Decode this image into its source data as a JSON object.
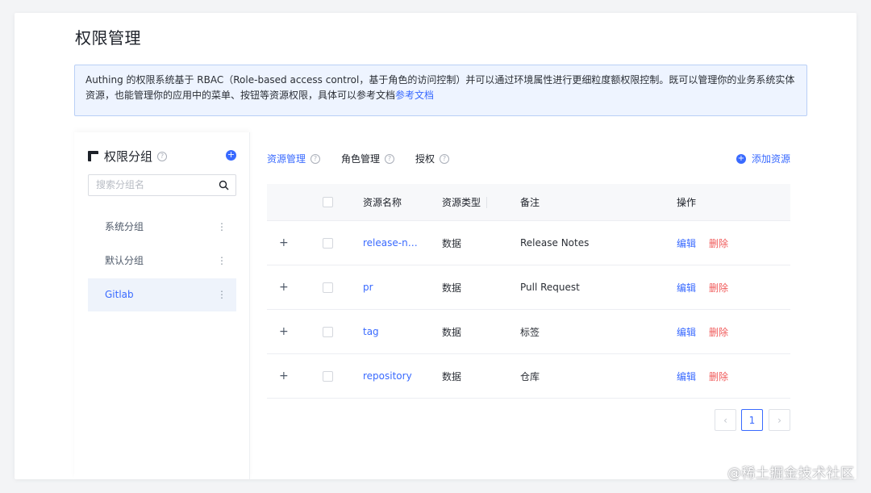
{
  "page": {
    "title": "权限管理"
  },
  "notice": {
    "text": "Authing 的权限系统基于 RBAC（Role-based access control，基于角色的访问控制）并可以通过环境属性进行更细粒度额权限控制。既可以管理你的业务系统实体资源，也能管理你的应用中的菜单、按钮等资源权限，具体可以参考文档",
    "link": "参考文档"
  },
  "sidebar": {
    "title": "权限分组",
    "search_placeholder": "搜索分组名",
    "groups": [
      {
        "label": "系统分组",
        "active": false
      },
      {
        "label": "默认分组",
        "active": false
      },
      {
        "label": "Gitlab",
        "active": true
      }
    ]
  },
  "tabs": [
    {
      "label": "资源管理",
      "active": true
    },
    {
      "label": "角色管理",
      "active": false
    },
    {
      "label": "授权",
      "active": false
    }
  ],
  "add_resource_label": "添加资源",
  "table": {
    "headers": {
      "name": "资源名称",
      "type": "资源类型",
      "note": "备注",
      "op": "操作"
    },
    "rows": [
      {
        "name": "release-notes",
        "type": "数据",
        "note": "Release Notes"
      },
      {
        "name": "pr",
        "type": "数据",
        "note": "Pull Request"
      },
      {
        "name": "tag",
        "type": "数据",
        "note": "标签"
      },
      {
        "name": "repository",
        "type": "数据",
        "note": "仓库"
      }
    ],
    "edit_label": "编辑",
    "delete_label": "删除"
  },
  "pagination": {
    "current_page": "1",
    "prev": "‹",
    "next": "›"
  },
  "watermark": "@稀土掘金技术社区",
  "colors": {
    "primary": "#396aff",
    "danger": "#f05a5a",
    "notice_bg": "#eef4ff"
  }
}
